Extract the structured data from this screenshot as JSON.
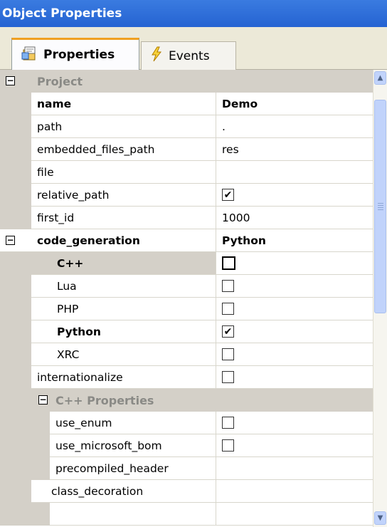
{
  "window": {
    "title": "Object Properties"
  },
  "tabs": [
    {
      "label": "Properties",
      "icon": "properties-icon"
    },
    {
      "label": "Events",
      "icon": "lightning-icon"
    }
  ],
  "project_category": {
    "label": "Project"
  },
  "properties": [
    {
      "name": "name",
      "value": "Demo"
    },
    {
      "name": "path",
      "value": "."
    },
    {
      "name": "embedded_files_path",
      "value": "res"
    },
    {
      "name": "file",
      "value": ""
    },
    {
      "name": "relative_path",
      "checked": true
    },
    {
      "name": "first_id",
      "value": "1000"
    }
  ],
  "code_generation": {
    "name": "code_generation",
    "value": "Python",
    "options": [
      {
        "name": "C++",
        "checked": false
      },
      {
        "name": "Lua",
        "checked": false
      },
      {
        "name": "PHP",
        "checked": false
      },
      {
        "name": "Python",
        "checked": true
      },
      {
        "name": "XRC",
        "checked": false
      }
    ]
  },
  "internationalize": {
    "name": "internationalize",
    "checked": false
  },
  "cpp_category": {
    "label": "C++ Properties"
  },
  "cpp_properties": [
    {
      "name": "use_enum",
      "checked": false
    },
    {
      "name": "use_microsoft_bom",
      "checked": false
    },
    {
      "name": "precompiled_header",
      "value": ""
    }
  ],
  "class_decoration": {
    "name": "class_decoration"
  },
  "colors": {
    "title_bar": "#2563d2",
    "gutter": "#d4d0c8",
    "scroll_thumb": "#c1d3fb"
  }
}
